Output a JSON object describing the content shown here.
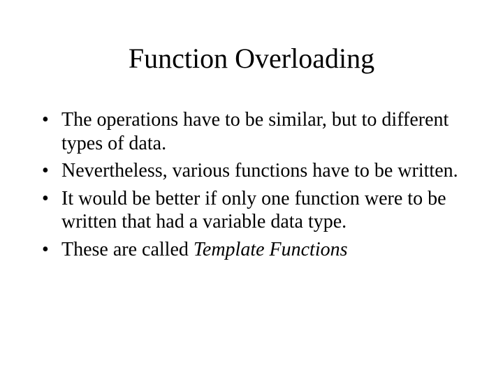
{
  "title": "Function Overloading",
  "bullets": [
    "The operations have to be similar, but to different types of data.",
    "Nevertheless, various functions have to be written.",
    "It would be better if only one function were to be written that had a variable data type.",
    "These are called "
  ],
  "bullet4_italic": "Template Functions"
}
